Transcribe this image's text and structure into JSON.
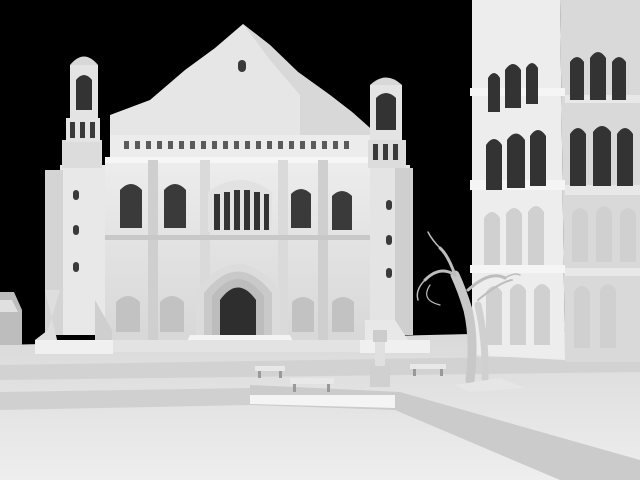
{
  "scene": {
    "title": "",
    "colors": {
      "sky": "#000000",
      "stone_light": "#f2f2f2",
      "stone_mid": "#dcdcdc",
      "stone_shadow": "#bdbdbd",
      "ground": "#e6e6e6",
      "ground_shadow": "#cfcfcf",
      "opening_dark": "#3a3a3a"
    },
    "objects": [
      {
        "name": "church-facade",
        "kind": "building"
      },
      {
        "name": "left-bell-tower",
        "kind": "tower"
      },
      {
        "name": "right-bell-tower",
        "kind": "tower"
      },
      {
        "name": "arcaded-tower-right",
        "kind": "building"
      },
      {
        "name": "bare-tree",
        "kind": "tree"
      },
      {
        "name": "fountain-pedestal",
        "kind": "statue"
      },
      {
        "name": "park-bench-1",
        "kind": "bench"
      },
      {
        "name": "park-bench-2",
        "kind": "bench"
      },
      {
        "name": "park-bench-3",
        "kind": "bench"
      },
      {
        "name": "plaza-ground",
        "kind": "ground"
      },
      {
        "name": "small-house-left",
        "kind": "building"
      }
    ]
  }
}
